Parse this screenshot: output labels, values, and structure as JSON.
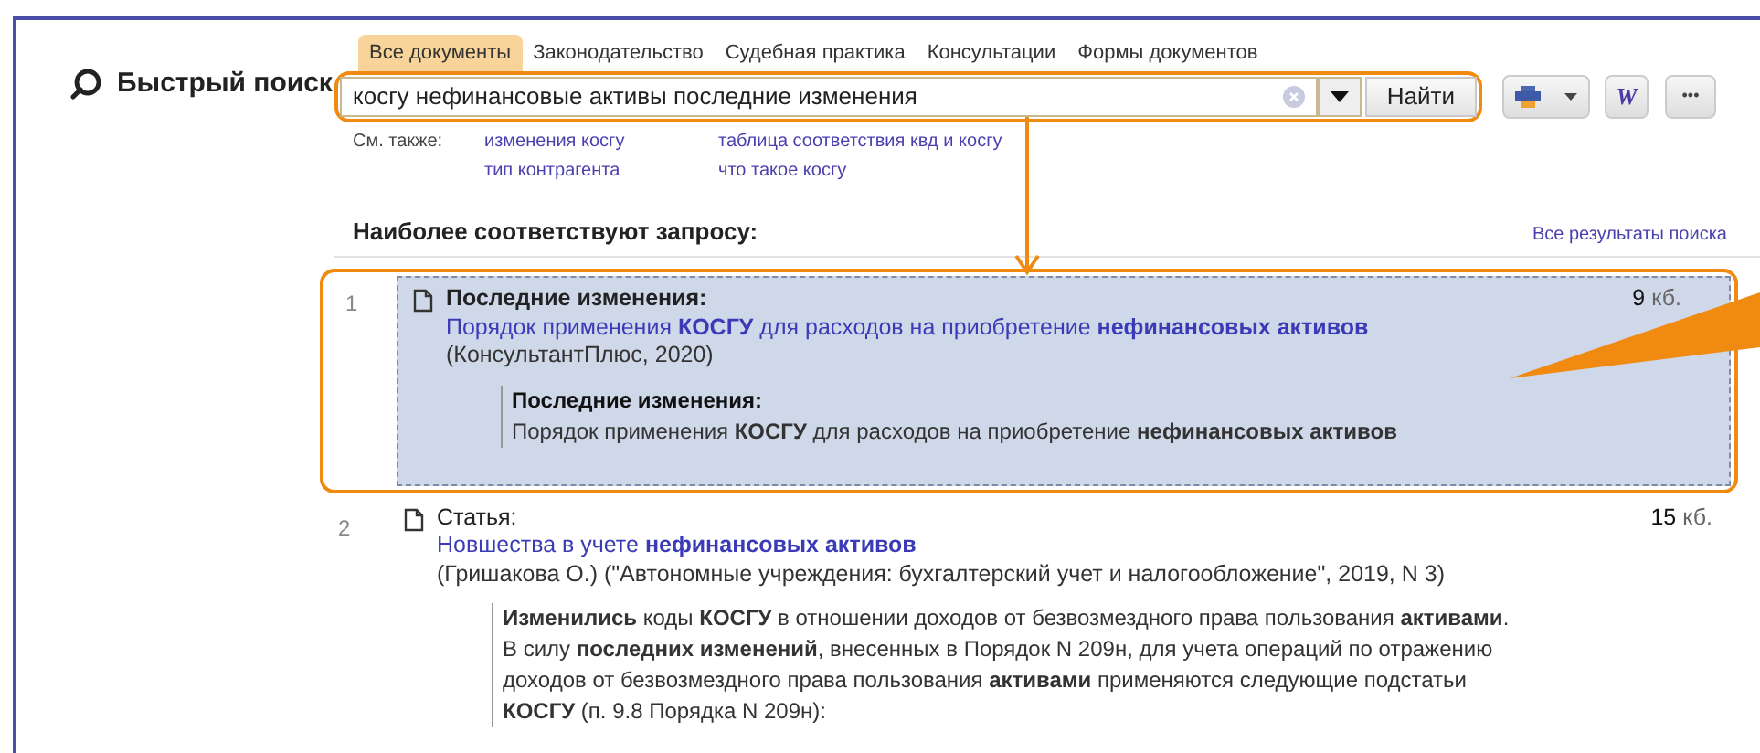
{
  "title": "Быстрый поиск",
  "tabs": [
    {
      "label": "Все документы",
      "selected": true
    },
    {
      "label": "Законодательство",
      "selected": false
    },
    {
      "label": "Судебная практика",
      "selected": false
    },
    {
      "label": "Консультации",
      "selected": false
    },
    {
      "label": "Формы документов",
      "selected": false
    }
  ],
  "search": {
    "value": "косгу нефинансовые активы последние изменения",
    "button": "Найти"
  },
  "toolbar": {
    "word_button": "W",
    "more_button": "•••"
  },
  "see_also": {
    "label": "См. также:",
    "links": [
      "изменения косгу",
      "таблица соответствия квд и косгу",
      "тип контрагента",
      "что такое косгу"
    ]
  },
  "results_heading": "Наиболее соответствуют запросу:",
  "all_results_link": "Все результаты поиска",
  "results": [
    {
      "number": "1",
      "selected": true,
      "type": "Последние изменения:",
      "title": "Порядок применения **КОСГУ** для расходов на приобретение **нефинансовых активов**",
      "source": "(КонсультантПлюс, 2020)",
      "size": "9",
      "unit": "кб.",
      "snippet_heading": "Последние изменения:",
      "snippet": "Порядок применения **КОСГУ** для расходов на приобретение **нефинансовых активов**"
    },
    {
      "number": "2",
      "selected": false,
      "type": "Статья:",
      "title": "Новшества в учете **нефинансовых активов**",
      "source": "(Гришакова О.) (\"Автономные учреждения: бухгалтерский учет и налогообложение\", 2019, N 3)",
      "size": "15",
      "unit": "кб.",
      "snippet": "**Изменились** коды **КОСГУ** в отношении доходов от безвозмездного права пользования **активами**. В силу **последних изменений**, внесенных в Порядок N 209н, для учета операций по отражению доходов от безвозмездного права пользования **активами** применяются следующие подстатьи **КОСГУ** (п. 9.8 Порядка N 209н):"
    }
  ]
}
